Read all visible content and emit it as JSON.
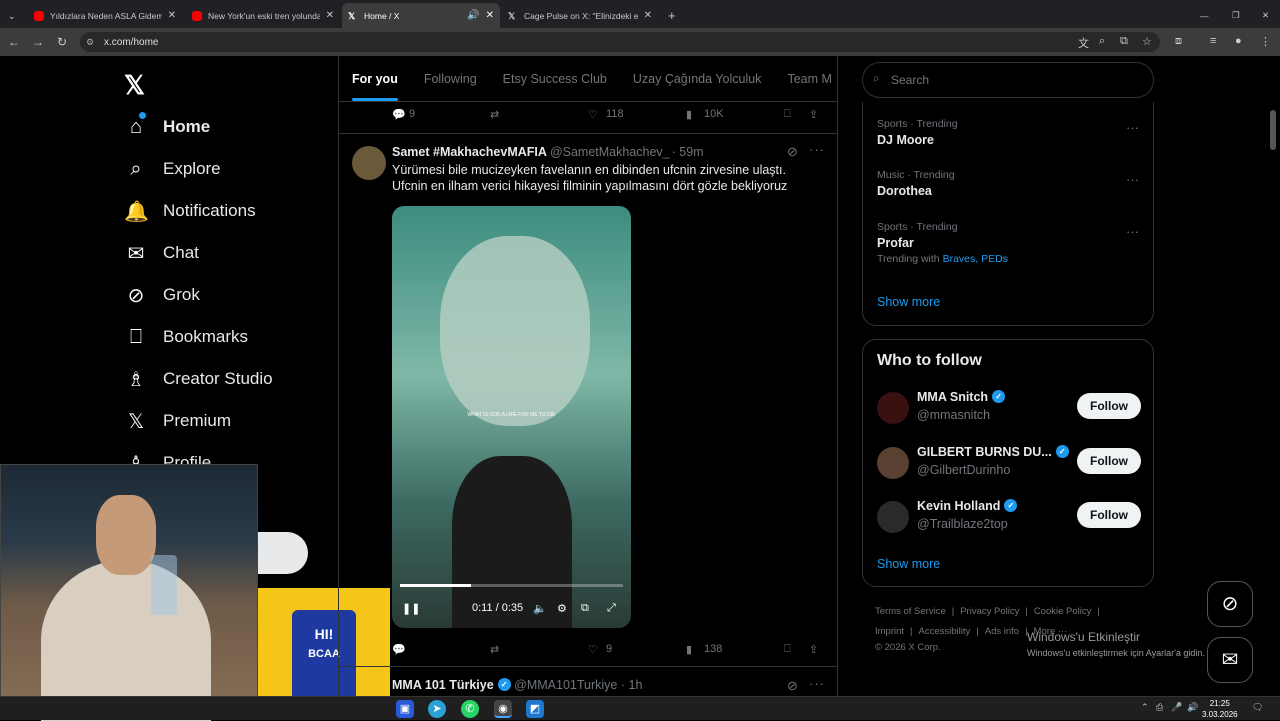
{
  "browser": {
    "tabs": [
      {
        "title": "Yıldızlara Neden ASLA Gideme"
      },
      {
        "title": "New York'un eski tren yolunda"
      },
      {
        "title": "Home / X"
      },
      {
        "title": "Cage Pulse on X: \"Elinizdeki en"
      }
    ],
    "url": "x.com/home",
    "new_tab": "+"
  },
  "nav": {
    "items": [
      {
        "label": "Home",
        "icon": "home-icon"
      },
      {
        "label": "Explore",
        "icon": "search-icon"
      },
      {
        "label": "Notifications",
        "icon": "bell-icon"
      },
      {
        "label": "Chat",
        "icon": "mail-icon"
      },
      {
        "label": "Grok",
        "icon": "grok-icon"
      },
      {
        "label": "Bookmarks",
        "icon": "bookmark-icon"
      },
      {
        "label": "Creator Studio",
        "icon": "creator-icon"
      },
      {
        "label": "Premium",
        "icon": "x-icon"
      },
      {
        "label": "Profile",
        "icon": "person-icon"
      }
    ]
  },
  "ad": {
    "brand": "HI!",
    "product": "BCAA"
  },
  "timeline": {
    "tabs": [
      "For you",
      "Following",
      "Etsy Success Club",
      "Uzay Çağında Yolculuk",
      "Team M"
    ],
    "prev_actions": {
      "replies": "9",
      "likes": "118",
      "views": "10K"
    },
    "tweet": {
      "name": "Samet #MakhachevMAFIA",
      "handle": "@SametMakhachev_",
      "time": "· 59m",
      "text1": "Yürümesi bile mucizeyken favelanın en dibinden ufcnin zirvesine ulaştı.",
      "text2": "Ufcnin en ilham verici hikayesi filminin yapılmasını dört gözle bekliyoruz",
      "video_caption": "WHAT IS GOD A LIFE FOR ME TO DIE",
      "video_time": "0:11 / 0:35",
      "progress": 0.32,
      "likes": "9",
      "views": "138"
    },
    "next": {
      "name": "MMA 101 Türkiye",
      "handle": "@MMA101Turkiye",
      "time": "· 1h"
    }
  },
  "sidebar": {
    "search_placeholder": "Search",
    "trends": [
      {
        "category": "Sports · Trending",
        "name": "DJ Moore"
      },
      {
        "category": "Music · Trending",
        "name": "Dorothea"
      },
      {
        "category": "Sports · Trending",
        "name": "Profar",
        "sub_prefix": "Trending with",
        "sub_links": "Braves, PEDs"
      }
    ],
    "show_more": "Show more",
    "who_to_follow": {
      "title": "Who to follow",
      "accounts": [
        {
          "name": "MMA Snitch",
          "handle": "@mmasnitch"
        },
        {
          "name": "GILBERT BURNS DU...",
          "handle": "@GilbertDurinho"
        },
        {
          "name": "Kevin Holland",
          "handle": "@Trailblaze2top"
        }
      ],
      "follow_label": "Follow",
      "show_more": "Show more"
    },
    "footer": {
      "links": [
        "Terms of Service",
        "|",
        "Privacy Policy",
        "|",
        "Cookie Policy",
        "|",
        "Imprint",
        "|",
        "Accessibility",
        "|",
        "Ads info",
        "|",
        "More ···"
      ],
      "copyright": "© 2026 X Corp."
    }
  },
  "windows": {
    "activate_title": "Windows'u Etkinleştir",
    "activate_sub": "Windows'u etkinleştirmek için Ayarlar'a gidin.",
    "time": "21:25",
    "date": "3.03.2026"
  }
}
